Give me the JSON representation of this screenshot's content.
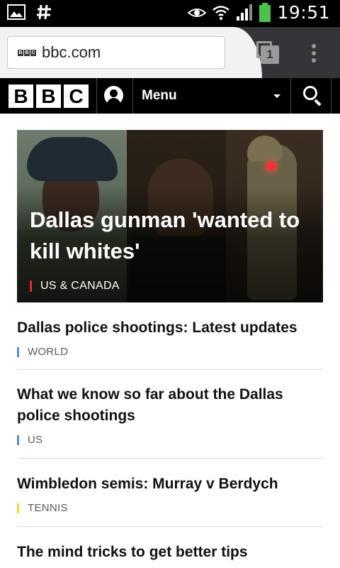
{
  "status_bar": {
    "time": "19:51",
    "icons": [
      "image-icon",
      "hash-icon",
      "eye-icon",
      "wifi-icon",
      "signal-icon",
      "battery-icon"
    ]
  },
  "browser": {
    "url": "bbc.com",
    "tab_count": "1",
    "favicon_letters": [
      "B",
      "B",
      "C"
    ]
  },
  "bbc_header": {
    "logo_letters": [
      "B",
      "B",
      "C"
    ],
    "menu_label": "Menu"
  },
  "hero": {
    "title": "Dallas gunman 'wanted to kill whites'",
    "tag": "US & CANADA",
    "tag_color": "#e8262c"
  },
  "stories": [
    {
      "title": "Dallas police shootings: Latest updates",
      "tag": "WORLD",
      "tag_color": "#5a8fb8"
    },
    {
      "title": "What we know so far about the Dallas police shootings",
      "tag": "US",
      "tag_color": "#5a8fb8"
    },
    {
      "title": "Wimbledon semis: Murray v Berdych",
      "tag": "TENNIS",
      "tag_color": "#ffd230"
    },
    {
      "title": "The mind tricks to get better tips",
      "tag": "",
      "tag_color": ""
    }
  ],
  "colors": {
    "status_bar_bg": "#000000",
    "browser_bar_bg": "#333538",
    "bbc_header_bg": "#000000"
  }
}
